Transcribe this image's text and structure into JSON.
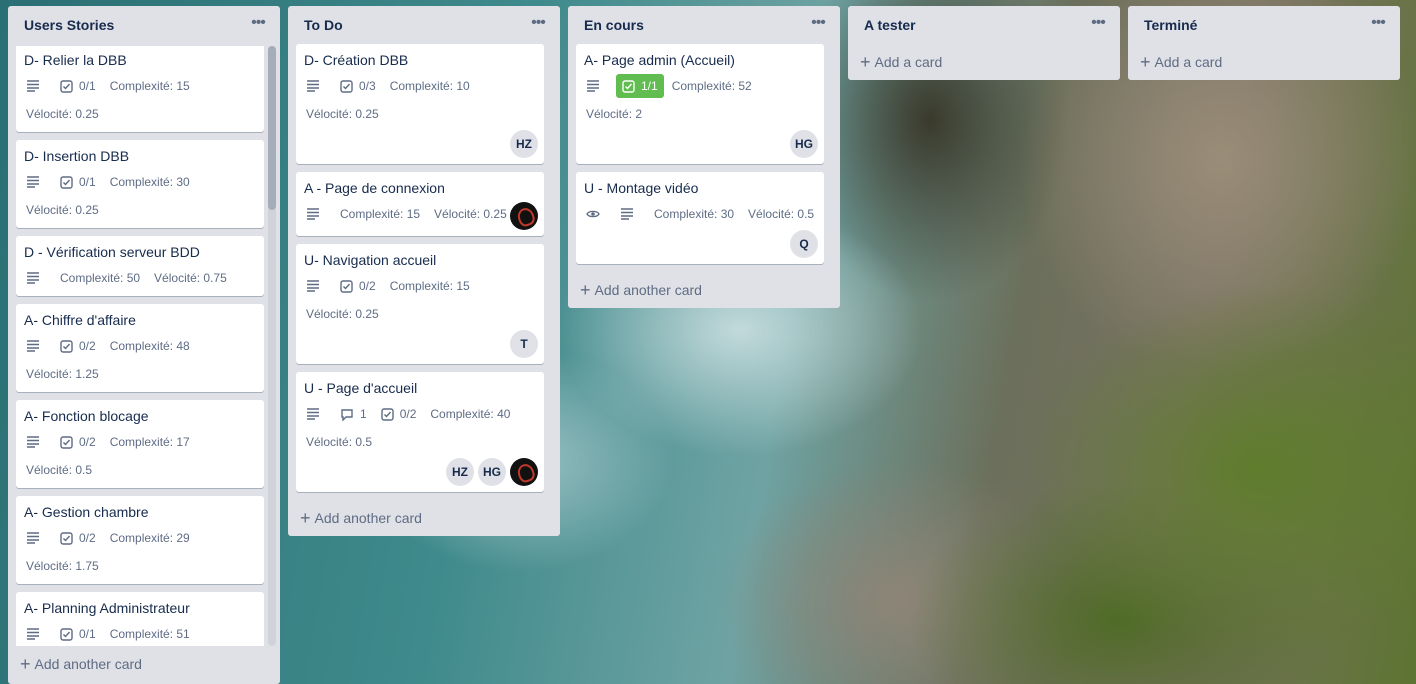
{
  "lists": [
    {
      "title": "Users Stories",
      "add_label": "Add another card",
      "cards": [
        {
          "title": "D- Relier la DBB",
          "checklist": "0/1",
          "complexite": "Complexité: 15",
          "velocite": "Vélocité: 0.25"
        },
        {
          "title": "D- Insertion DBB",
          "checklist": "0/1",
          "complexite": "Complexité: 30",
          "velocite": "Vélocité: 0.25"
        },
        {
          "title": "D - Vérification serveur BDD",
          "complexite": "Complexité: 50",
          "velocite": "Vélocité: 0.75"
        },
        {
          "title": "A- Chiffre d'affaire",
          "checklist": "0/2",
          "complexite": "Complexité: 48",
          "velocite": "Vélocité: 1.25"
        },
        {
          "title": "A- Fonction blocage",
          "checklist": "0/2",
          "complexite": "Complexité: 17",
          "velocite": "Vélocité: 0.5"
        },
        {
          "title": "A- Gestion chambre",
          "checklist": "0/2",
          "complexite": "Complexité: 29",
          "velocite": "Vélocité: 1.75"
        },
        {
          "title": "A- Planning Administrateur",
          "checklist": "0/1",
          "complexite": "Complexité: 51"
        }
      ]
    },
    {
      "title": "To Do",
      "add_label": "Add another card",
      "cards": [
        {
          "title": "D- Création DBB",
          "checklist": "0/3",
          "complexite": "Complexité: 10",
          "velocite": "Vélocité: 0.25",
          "members": [
            "HZ"
          ]
        },
        {
          "title": "A - Page de connexion",
          "complexite": "Complexité: 15",
          "velocite": "Vélocité: 0.25"
        },
        {
          "title": "U- Navigation accueil",
          "checklist": "0/2",
          "complexite": "Complexité: 15",
          "velocite": "Vélocité: 0.25",
          "members": [
            "T"
          ]
        },
        {
          "title": "U - Page d'accueil",
          "comments": "1",
          "checklist": "0/2",
          "complexite": "Complexité: 40",
          "velocite": "Vélocité: 0.5",
          "members": [
            "HZ",
            "HG"
          ]
        }
      ]
    },
    {
      "title": "En cours",
      "add_label": "Add another card",
      "cards": [
        {
          "title": "A- Page admin (Accueil)",
          "checklist": "1/1",
          "complexite": "Complexité: 52",
          "velocite": "Vélocité: 2",
          "members": [
            "HG"
          ]
        },
        {
          "title": "U - Montage vidéo",
          "complexite": "Complexité: 30",
          "velocite": "Vélocité: 0.5",
          "members": [
            "Q"
          ]
        }
      ]
    },
    {
      "title": "A tester",
      "add_label": "Add a card"
    },
    {
      "title": "Terminé",
      "add_label": "Add a card"
    }
  ],
  "menu_icon": "more-horizontal-icon",
  "colors": {
    "list_bg": "#dfe1e6",
    "card_bg": "#ffffff",
    "checklist_complete": "#61bd4f"
  }
}
